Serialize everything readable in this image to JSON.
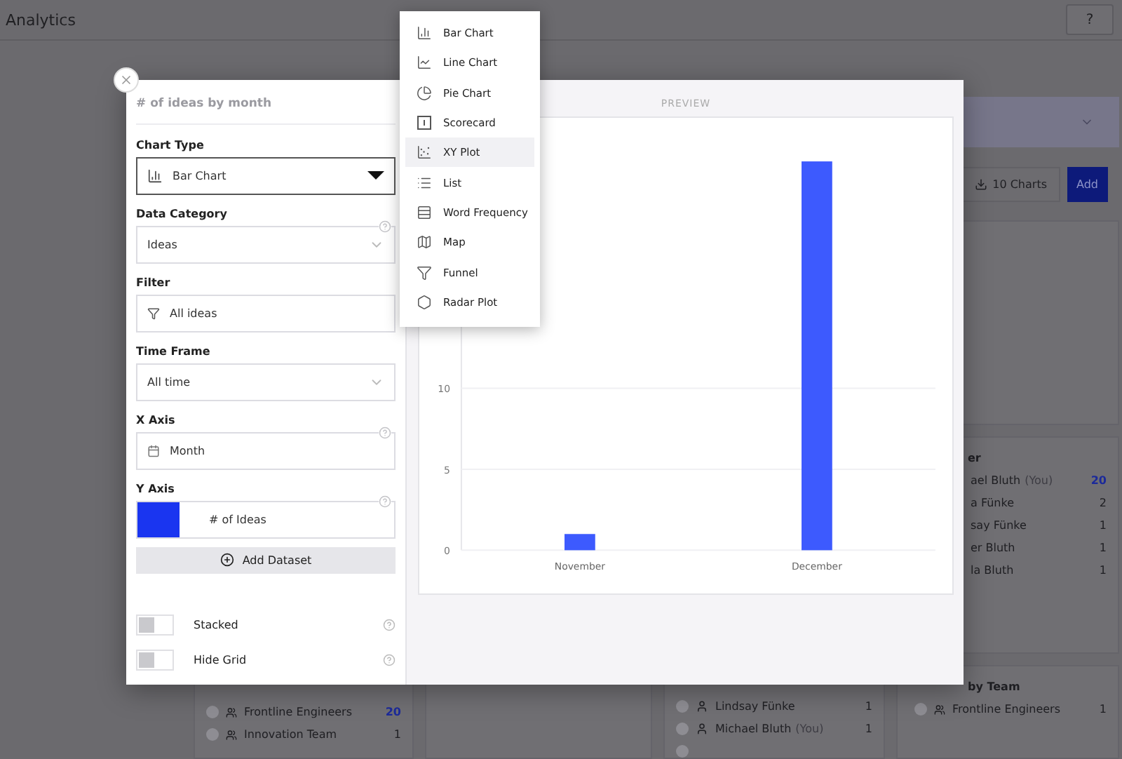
{
  "header": {
    "title": "Analytics",
    "help_label": "?"
  },
  "background": {
    "toolbar": {
      "charts_label": "10 Charts",
      "add_label": "Add"
    },
    "team_card": {
      "rows": [
        {
          "name": "Frontline Engineers",
          "value": "20"
        },
        {
          "name": "Innovation Team",
          "value": "1"
        }
      ]
    },
    "people_card": {
      "rows": [
        {
          "name": "Lindsay Fünke",
          "suffix": "",
          "value": "1"
        },
        {
          "name": "Michael Bluth",
          "suffix": "(You)",
          "value": "1"
        }
      ]
    },
    "leader_card": {
      "title": "er",
      "rows": [
        {
          "name": "ael Bluth",
          "suffix": "(You)",
          "value": "20"
        },
        {
          "name": "a Fünke",
          "suffix": "",
          "value": "2"
        },
        {
          "name": "say Fünke",
          "suffix": "",
          "value": "1"
        },
        {
          "name": "er Bluth",
          "suffix": "",
          "value": "1"
        },
        {
          "name": "la Bluth",
          "suffix": "",
          "value": "1"
        }
      ]
    },
    "by_team_card": {
      "title": "by Team",
      "rows": [
        {
          "name": "Frontline Engineers",
          "value": "1"
        }
      ]
    }
  },
  "modal": {
    "title": "# of ideas by month",
    "fields": [
      {
        "kind": "select",
        "label": "Chart Type",
        "value": "Bar Chart",
        "open": true,
        "info": false
      },
      {
        "kind": "select",
        "label": "Data Category",
        "value": "Ideas",
        "open": false,
        "info": true
      },
      {
        "kind": "input",
        "label": "Filter",
        "value": "All ideas",
        "info": false
      },
      {
        "kind": "select",
        "label": "Time Frame",
        "value": "All time",
        "open": false,
        "info": false
      },
      {
        "kind": "input",
        "label": "X Axis",
        "value": "Month",
        "info": true
      },
      {
        "kind": "color",
        "label": "Y Axis",
        "value": "# of Ideas",
        "color": "#1a35f0",
        "info": true
      }
    ],
    "add_dataset": "Add Dataset",
    "toggles": [
      {
        "label": "Stacked",
        "on": false
      },
      {
        "label": "Hide Grid",
        "on": false
      }
    ],
    "preview_label": "PREVIEW",
    "chart_data": {
      "type": "bar",
      "categories": [
        "November",
        "December"
      ],
      "series": [
        {
          "color": "#3d5afe",
          "values": [
            1,
            24
          ]
        }
      ],
      "ylim": [
        0,
        26
      ],
      "yticks": [
        0,
        5,
        10
      ]
    }
  },
  "menu": {
    "items": [
      {
        "label": "Bar Chart",
        "selected": false
      },
      {
        "label": "Line Chart",
        "selected": false
      },
      {
        "label": "Pie Chart",
        "selected": false
      },
      {
        "label": "Scorecard",
        "selected": false
      },
      {
        "label": "XY Plot",
        "selected": true
      },
      {
        "label": "List",
        "selected": false
      },
      {
        "label": "Word Frequency",
        "selected": false
      },
      {
        "label": "Map",
        "selected": false
      },
      {
        "label": "Funnel",
        "selected": false
      },
      {
        "label": "Radar Plot",
        "selected": false
      }
    ]
  }
}
